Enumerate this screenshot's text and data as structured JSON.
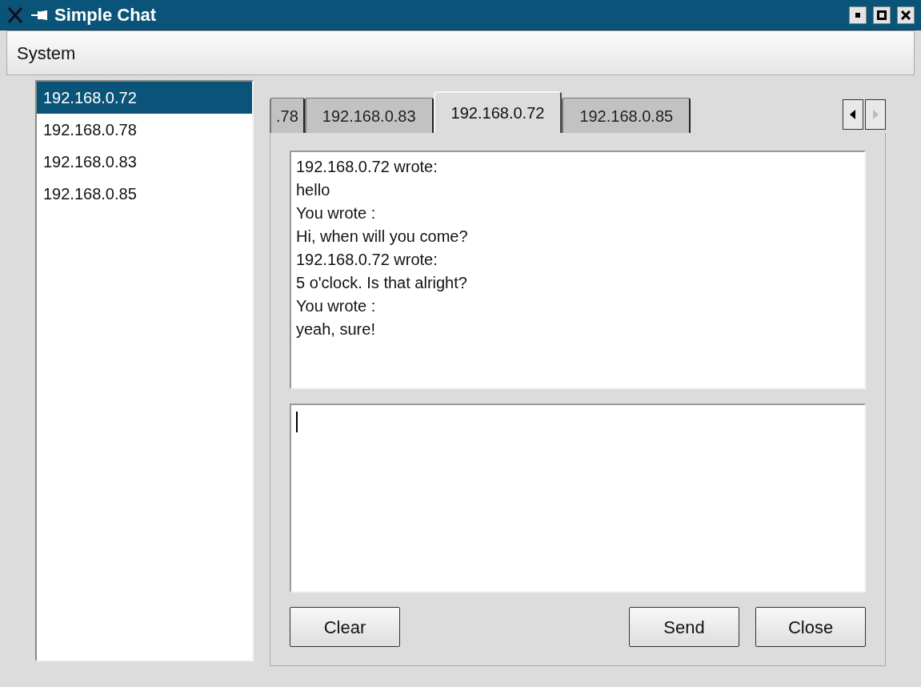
{
  "window": {
    "title": "Simple Chat"
  },
  "menu": [
    "System"
  ],
  "hosts": [
    {
      "label": "192.168.0.72",
      "selected": true
    },
    {
      "label": "192.168.0.78",
      "selected": false
    },
    {
      "label": "192.168.0.83",
      "selected": false
    },
    {
      "label": "192.168.0.85",
      "selected": false
    }
  ],
  "tabs": [
    {
      "label": ".78",
      "selected": false
    },
    {
      "label": "192.168.0.83",
      "selected": false
    },
    {
      "label": "192.168.0.72",
      "selected": true
    },
    {
      "label": "192.168.0.85",
      "selected": false
    }
  ],
  "tab_scroll": [
    {
      "kind": "left",
      "disabled": false
    },
    {
      "kind": "right",
      "disabled": true
    }
  ],
  "messages": [
    "192.168.0.72 wrote:",
    "hello",
    "You wrote :",
    "Hi, when will you come?",
    "192.168.0.72 wrote:",
    "5 o'clock. Is that alright?",
    "You wrote :",
    "yeah, sure!"
  ],
  "buttons_left": [
    "Clear"
  ],
  "buttons_right": [
    "Send",
    "Close"
  ]
}
